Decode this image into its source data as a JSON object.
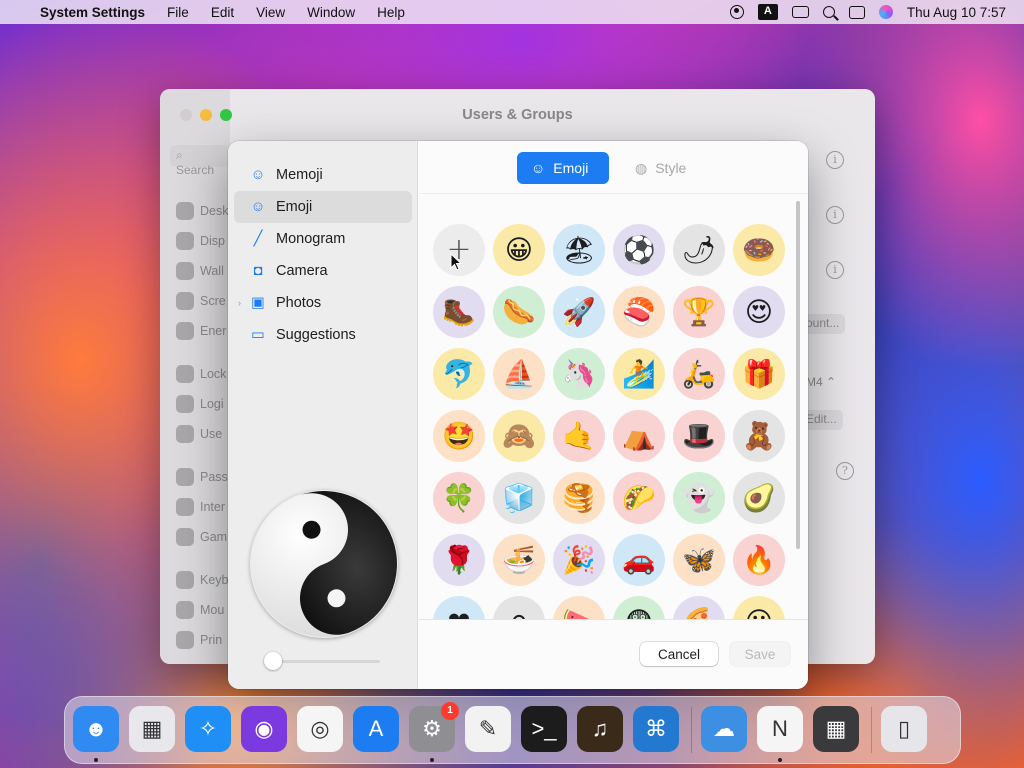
{
  "menubar": {
    "apple_symbol": "",
    "app_name": "System Settings",
    "menus": [
      "File",
      "Edit",
      "View",
      "Window",
      "Help"
    ],
    "status_icons": [
      "user-icon",
      "keyboard-a-icon",
      "screen-mirroring-icon",
      "search-icon",
      "control-center-icon",
      "siri-icon"
    ],
    "keyboard_letter": "A",
    "clock": "Thu Aug 10  7:57"
  },
  "background_window": {
    "title": "Users & Groups",
    "search_placeholder": "Search",
    "sidebar_items": [
      "Desk",
      "Disp",
      "Wall",
      "Scre",
      "Ener",
      "Lock",
      "Logi",
      "Use",
      "Pass",
      "Inter",
      "Gam",
      "Keyb",
      "Mou",
      "Prin"
    ],
    "buttons": [
      "ount...",
      "Edit..."
    ],
    "stepper_value": "M4",
    "info_glyph": "i",
    "help_glyph": "?"
  },
  "dialog": {
    "sidebar": {
      "items": [
        {
          "label": "Memoji",
          "icon": "memoji-icon",
          "glyph": "☺"
        },
        {
          "label": "Emoji",
          "icon": "emoji-icon",
          "glyph": "☺",
          "selected": true
        },
        {
          "label": "Monogram",
          "icon": "pencil-icon",
          "glyph": "╱"
        },
        {
          "label": "Camera",
          "icon": "camera-icon",
          "glyph": "◘"
        },
        {
          "label": "Photos",
          "icon": "photos-icon",
          "glyph": "▣",
          "disclosure": "›"
        },
        {
          "label": "Suggestions",
          "icon": "folder-icon",
          "glyph": "▭"
        }
      ],
      "preview_image": "yin-yang",
      "zoom_slider_value": 0
    },
    "tabs": {
      "emoji_label": "Emoji",
      "style_label": "Style",
      "emoji_glyph": "☺",
      "style_glyph": "◍",
      "selected": "Emoji"
    },
    "emoji_grid": [
      {
        "emoji": "+",
        "bg": "#ececec",
        "name": "add-emoji-button"
      },
      {
        "emoji": "😀",
        "bg": "#fbeaa7",
        "name": "emoji-grinning"
      },
      {
        "emoji": "🏖",
        "bg": "#cfe7f7",
        "name": "emoji-beach-umbrella"
      },
      {
        "emoji": "⚽",
        "bg": "#e2dcf1",
        "name": "emoji-soccer-ball"
      },
      {
        "emoji": "🌶",
        "bg": "#e4e4e4",
        "name": "emoji-hot-pepper"
      },
      {
        "emoji": "🍩",
        "bg": "#fbeaa7",
        "name": "emoji-doughnut"
      },
      {
        "emoji": "🥾",
        "bg": "#e2dcf1",
        "name": "emoji-hiking-boot"
      },
      {
        "emoji": "🌭",
        "bg": "#cfeed3",
        "name": "emoji-hot-dog"
      },
      {
        "emoji": "🚀",
        "bg": "#cfe7f7",
        "name": "emoji-rocket"
      },
      {
        "emoji": "🍣",
        "bg": "#fde1c6",
        "name": "emoji-sushi"
      },
      {
        "emoji": "🏆",
        "bg": "#f9d2d2",
        "name": "emoji-trophy"
      },
      {
        "emoji": "😍",
        "bg": "#e2dcf1",
        "name": "emoji-heart-eyes"
      },
      {
        "emoji": "🐬",
        "bg": "#fbeaa7",
        "name": "emoji-dolphin"
      },
      {
        "emoji": "⛵",
        "bg": "#fde1c6",
        "name": "emoji-sailboat"
      },
      {
        "emoji": "🦄",
        "bg": "#cfeed3",
        "name": "emoji-unicorn"
      },
      {
        "emoji": "🏄",
        "bg": "#fbeaa7",
        "name": "emoji-surfer"
      },
      {
        "emoji": "🛵",
        "bg": "#f9d2d2",
        "name": "emoji-scooter"
      },
      {
        "emoji": "🎁",
        "bg": "#fbeaa7",
        "name": "emoji-gift"
      },
      {
        "emoji": "🤩",
        "bg": "#fde1c6",
        "name": "emoji-star-struck"
      },
      {
        "emoji": "🙈",
        "bg": "#fbeaa7",
        "name": "emoji-see-no-evil"
      },
      {
        "emoji": "🤙",
        "bg": "#f9d2d2",
        "name": "emoji-call-me-hand"
      },
      {
        "emoji": "⛺",
        "bg": "#f9d2d2",
        "name": "emoji-tent"
      },
      {
        "emoji": "🎩",
        "bg": "#f9d2d2",
        "name": "emoji-top-hat"
      },
      {
        "emoji": "🧸",
        "bg": "#e4e4e4",
        "name": "emoji-teddy-bear"
      },
      {
        "emoji": "🍀",
        "bg": "#f9d2d2",
        "name": "emoji-four-leaf-clover"
      },
      {
        "emoji": "🧊",
        "bg": "#e4e4e4",
        "name": "emoji-ice-cube"
      },
      {
        "emoji": "🥞",
        "bg": "#fde1c6",
        "name": "emoji-pancakes"
      },
      {
        "emoji": "🌮",
        "bg": "#f9d2d2",
        "name": "emoji-taco"
      },
      {
        "emoji": "👻",
        "bg": "#cfeed3",
        "name": "emoji-ghost"
      },
      {
        "emoji": "🥑",
        "bg": "#e4e4e4",
        "name": "emoji-avocado"
      },
      {
        "emoji": "🌹",
        "bg": "#e2dcf1",
        "name": "emoji-rose"
      },
      {
        "emoji": "🍜",
        "bg": "#fde1c6",
        "name": "emoji-noodles"
      },
      {
        "emoji": "🎉",
        "bg": "#e2dcf1",
        "name": "emoji-party-popper"
      },
      {
        "emoji": "🚗",
        "bg": "#cfe7f7",
        "name": "emoji-car"
      },
      {
        "emoji": "🦋",
        "bg": "#fde1c6",
        "name": "emoji-butterfly"
      },
      {
        "emoji": "🔥",
        "bg": "#f9d2d2",
        "name": "emoji-fire"
      },
      {
        "emoji": "❤",
        "bg": "#cfe7f7",
        "name": "emoji-partial-1"
      },
      {
        "emoji": "⚪",
        "bg": "#e4e4e4",
        "name": "emoji-partial-2"
      },
      {
        "emoji": "🍉",
        "bg": "#fde1c6",
        "name": "emoji-partial-3"
      },
      {
        "emoji": "😨",
        "bg": "#cfeed3",
        "name": "emoji-partial-4"
      },
      {
        "emoji": "🍕",
        "bg": "#e2dcf1",
        "name": "emoji-partial-5"
      },
      {
        "emoji": "😶",
        "bg": "#fbeaa7",
        "name": "emoji-partial-6"
      }
    ],
    "buttons": {
      "cancel": "Cancel",
      "save": "Save"
    }
  },
  "dock": {
    "apps": [
      {
        "name": "finder",
        "glyph": "☻",
        "bg": "#2f8bf1",
        "running": true
      },
      {
        "name": "launchpad",
        "glyph": "▦",
        "bg": "#e8e8ec"
      },
      {
        "name": "safari",
        "glyph": "✧",
        "bg": "#1f8ef5"
      },
      {
        "name": "firefox",
        "glyph": "◉",
        "bg": "#7b3ae0"
      },
      {
        "name": "chrome",
        "glyph": "◎",
        "bg": "#f5f5f5"
      },
      {
        "name": "app-store",
        "glyph": "A",
        "bg": "#1d7cf2"
      },
      {
        "name": "system-settings",
        "glyph": "⚙",
        "bg": "#8e8e93",
        "running": true,
        "badge": "1"
      },
      {
        "name": "textedit",
        "glyph": "✎",
        "bg": "#f2f2f2"
      },
      {
        "name": "terminal",
        "glyph": ">_",
        "bg": "#1c1c1c"
      },
      {
        "name": "garageband",
        "glyph": "♫",
        "bg": "#3a2a1a"
      },
      {
        "name": "vscode",
        "glyph": "⌘",
        "bg": "#2379cf"
      },
      {
        "name": "weather",
        "glyph": "☁",
        "bg": "#3d8fe3"
      },
      {
        "name": "news",
        "glyph": "N",
        "bg": "#f5f5f5",
        "running": true
      },
      {
        "name": "calculator",
        "glyph": "▦",
        "bg": "#3a3a3c"
      },
      {
        "name": "trash",
        "glyph": "▯",
        "bg": "#e6e6ea"
      }
    ]
  }
}
